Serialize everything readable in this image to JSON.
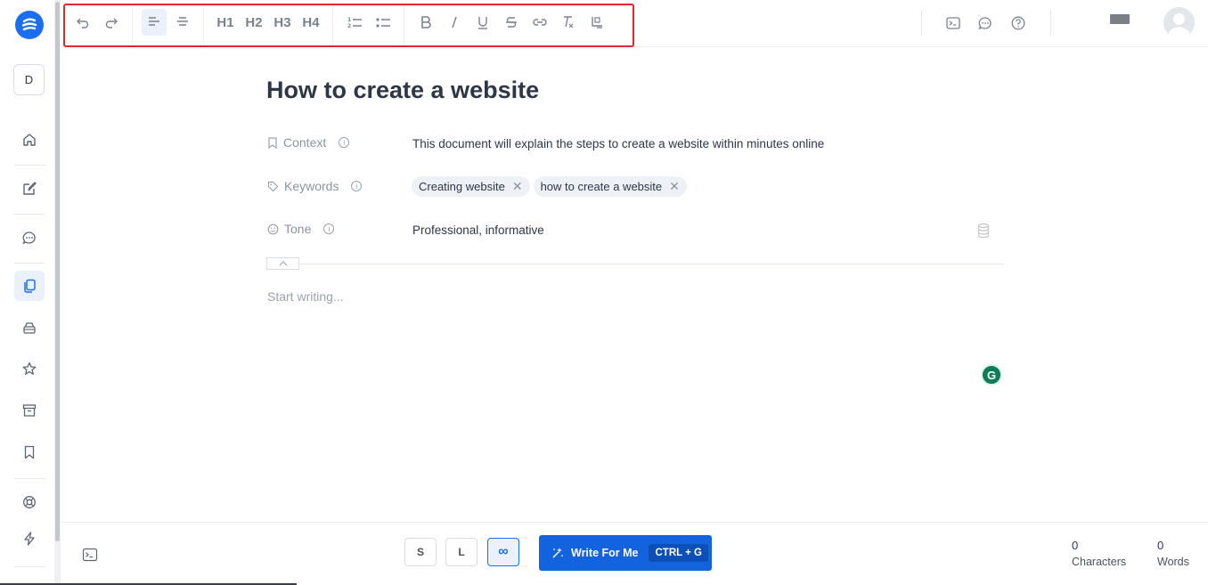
{
  "workspace": {
    "initial": "D"
  },
  "toolbar": {
    "headings": [
      "H1",
      "H2",
      "H3",
      "H4"
    ]
  },
  "document": {
    "title": "How to create a website",
    "context": {
      "label": "Context",
      "value": "This document will explain the steps to create a website within minutes online"
    },
    "keywords": {
      "label": "Keywords",
      "chips": [
        "Creating website",
        "how to create a website"
      ]
    },
    "tone": {
      "label": "Tone",
      "value": "Professional, informative"
    },
    "placeholder": "Start writing..."
  },
  "bottom": {
    "sizes": [
      "S",
      "L",
      "∞"
    ],
    "write_label": "Write For Me",
    "shortcut": "CTRL + G",
    "characters": {
      "count": "0",
      "label": "Characters"
    },
    "words": {
      "count": "0",
      "label": "Words"
    }
  },
  "colors": {
    "brand": "#1a6ff0",
    "cta": "#1263dd",
    "highlight_border": "#e0282e"
  }
}
